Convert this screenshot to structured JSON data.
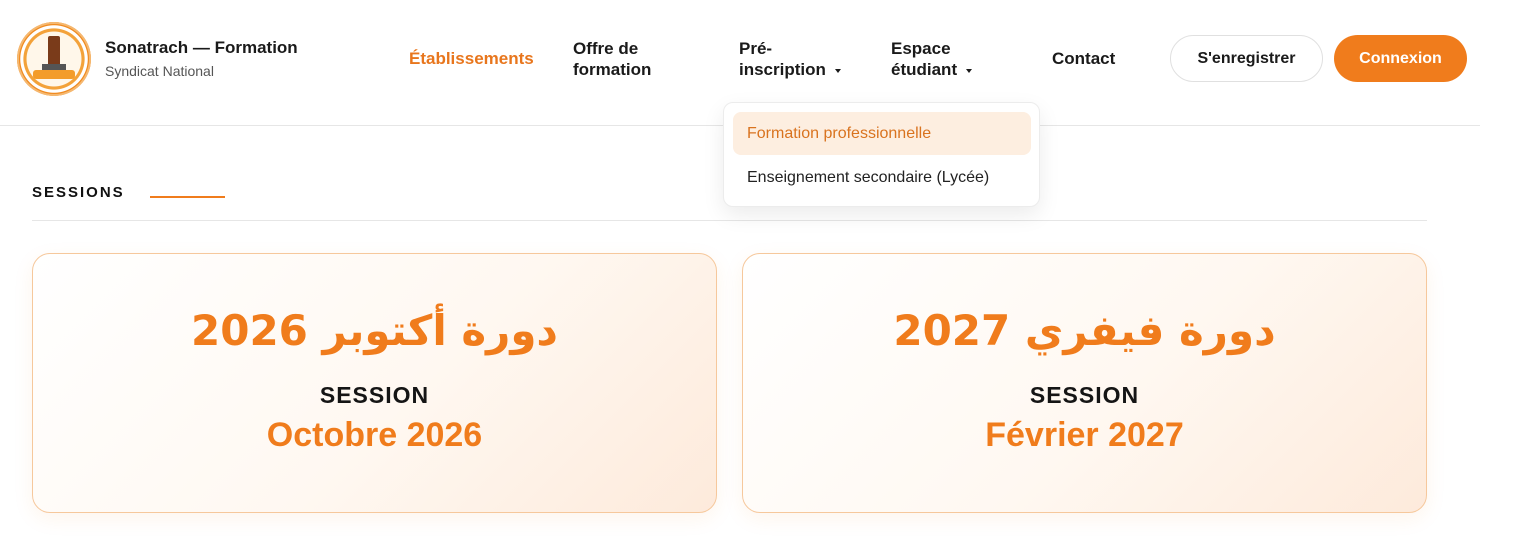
{
  "brand": {
    "title": "Sonatrach — Formation",
    "subtitle": "Syndicat National",
    "logo_icon": "syndicate-emblem-icon"
  },
  "nav": {
    "items": [
      {
        "label": "Établissements",
        "active": true
      },
      {
        "label": "Offre de formation"
      },
      {
        "label": "Pré-inscription",
        "has_dropdown": true,
        "open": true
      },
      {
        "label": "Espace étudiant",
        "has_dropdown": true
      },
      {
        "label": "Contact"
      }
    ],
    "preinscription_line1": "Pré-",
    "preinscription_line2": "inscription",
    "offre_line1": "Offre de",
    "offre_line2": "formation",
    "espace_line1": "Espace",
    "espace_line2": "étudiant"
  },
  "actions": {
    "register_label": "S'enregistrer",
    "login_label": "Connexion"
  },
  "dropdown": {
    "items": [
      {
        "label": "Formation professionnelle",
        "highlighted": true
      },
      {
        "label": "Enseignement secondaire (Lycée)"
      }
    ]
  },
  "section": {
    "label": "SESSIONS"
  },
  "sessions": [
    {
      "arabic": "دورة أكتوبر 2026",
      "kicker": "SESSION",
      "title": "Octobre 2026"
    },
    {
      "arabic": "دورة فيفري 2027",
      "kicker": "SESSION",
      "title": "Février 2027"
    }
  ],
  "colors": {
    "accent": "#f07c1c",
    "accent_text": "#e8761d",
    "dropdown_highlight_bg": "#fdeee0",
    "text": "#1a1a1a",
    "card_border": "#f6c89c"
  }
}
